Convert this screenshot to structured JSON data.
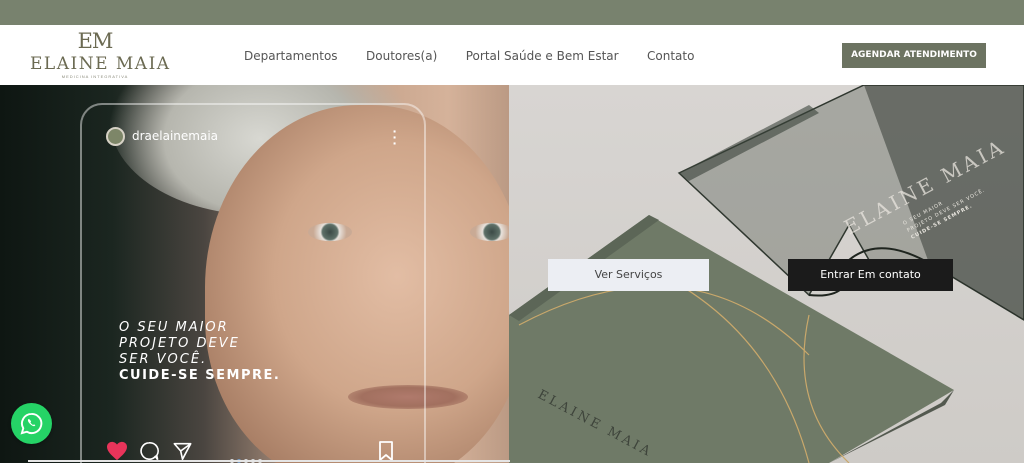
{
  "brand": {
    "monogram": "EM",
    "name": "ELAINE MAIA",
    "tagline": "MEDICINA INTEGRATIVA"
  },
  "nav": {
    "items": [
      {
        "label": "Departamentos"
      },
      {
        "label": "Doutores(a)"
      },
      {
        "label": "Portal Saúde e Bem Estar"
      },
      {
        "label": "Contato"
      }
    ],
    "cta_label": "AGENDAR ATENDIMENTO"
  },
  "hero": {
    "instagram_user": "draelainemaia",
    "quote_lines": [
      "O SEU MAIOR",
      "PROJETO DEVE",
      "SER VOCÊ."
    ],
    "quote_emphasis": "CUIDE-SE SEMPRE.",
    "book_cover_text": "ELAINE MAIA",
    "box_lid_text": "ELAINE MAIA",
    "box_lid_slogan": [
      "O SEU MAIOR",
      "PROJETO DEVE SER VOCÊ.",
      "CUIDE-SE SEMPRE."
    ],
    "services_button": "Ver Serviços",
    "contact_button": "Entrar Em contato"
  },
  "colors": {
    "topbar": "#78826e",
    "brand": "#6c7361",
    "whatsapp": "#25d366",
    "dark_button": "#1b1b1b",
    "heart": "#e8345a"
  },
  "icons": {
    "whatsapp": "whatsapp-icon",
    "heart": "heart-icon",
    "comment": "comment-icon",
    "share": "send-icon",
    "bookmark": "bookmark-icon",
    "menu": "kebab-icon"
  }
}
